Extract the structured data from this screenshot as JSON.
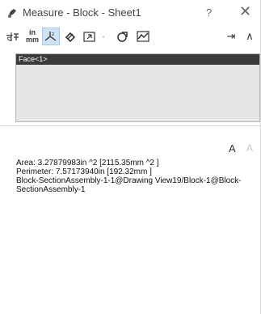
{
  "window": {
    "title": "Measure - Block - Sheet1",
    "help_label": "?",
    "close_label": "✕"
  },
  "toolbar": {
    "units_top": "in",
    "units_bottom": "mm",
    "pin_label": "⇥",
    "collapse_label": "∧"
  },
  "selection": {
    "items": [
      "Face<1>"
    ]
  },
  "font_controls": {
    "increase": "A",
    "decrease": "A"
  },
  "results": {
    "area": "Area: 3.27879983in ^2  [2115.35mm ^2 ]",
    "perimeter": "Perimeter: 7.57173940in  [192.32mm ]",
    "entity": "Block-SectionAssembly-1-1@Drawing View19/Block-1@Block-SectionAssembly-1"
  },
  "colors": {
    "selection_highlight": "#3b3b3b",
    "active_button": "#cfe3f6"
  }
}
